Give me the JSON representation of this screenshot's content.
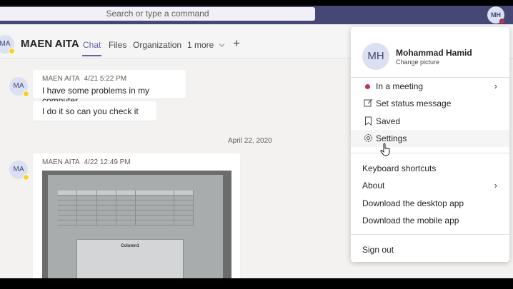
{
  "topbar": {
    "search_placeholder": "Search or type a command",
    "avatar_initials": "MH"
  },
  "header": {
    "avatar_initials": "MA",
    "title": "MAEN AITA",
    "tabs": [
      {
        "label": "Chat"
      },
      {
        "label": "Files"
      },
      {
        "label": "Organization"
      },
      {
        "label": "1 more"
      }
    ],
    "add_tab": "+"
  },
  "chat": {
    "messages": [
      {
        "avatar_initials": "MA",
        "sender": "MAEN AITA",
        "time": "4/21 5:22 PM",
        "lines": [
          "I have some problems in my computer",
          "I do it so can you check it"
        ]
      },
      {
        "avatar_initials": "MA",
        "sender": "MAEN AITA",
        "time": "4/22 12:49 PM",
        "attachment_caption": "Column1"
      }
    ],
    "date_divider": "April 22, 2020"
  },
  "profile_menu": {
    "avatar_initials": "MH",
    "name": "Mohammad Hamid",
    "change_picture": "Change picture",
    "items": [
      {
        "label": "In a meeting",
        "icon": "red-status-dot"
      },
      {
        "label": "Set status message",
        "icon": "edit-icon"
      },
      {
        "label": "Saved",
        "icon": "bookmark-icon"
      },
      {
        "label": "Settings",
        "icon": "gear-icon"
      }
    ],
    "links": [
      {
        "label": "Keyboard shortcuts"
      },
      {
        "label": "About"
      },
      {
        "label": "Download the desktop app"
      },
      {
        "label": "Download the mobile app"
      }
    ],
    "sign_out": "Sign out"
  },
  "colors": {
    "topbar": "#464775",
    "accent": "#6264a7",
    "busy": "#c4314b",
    "away": "#f8d22a"
  }
}
